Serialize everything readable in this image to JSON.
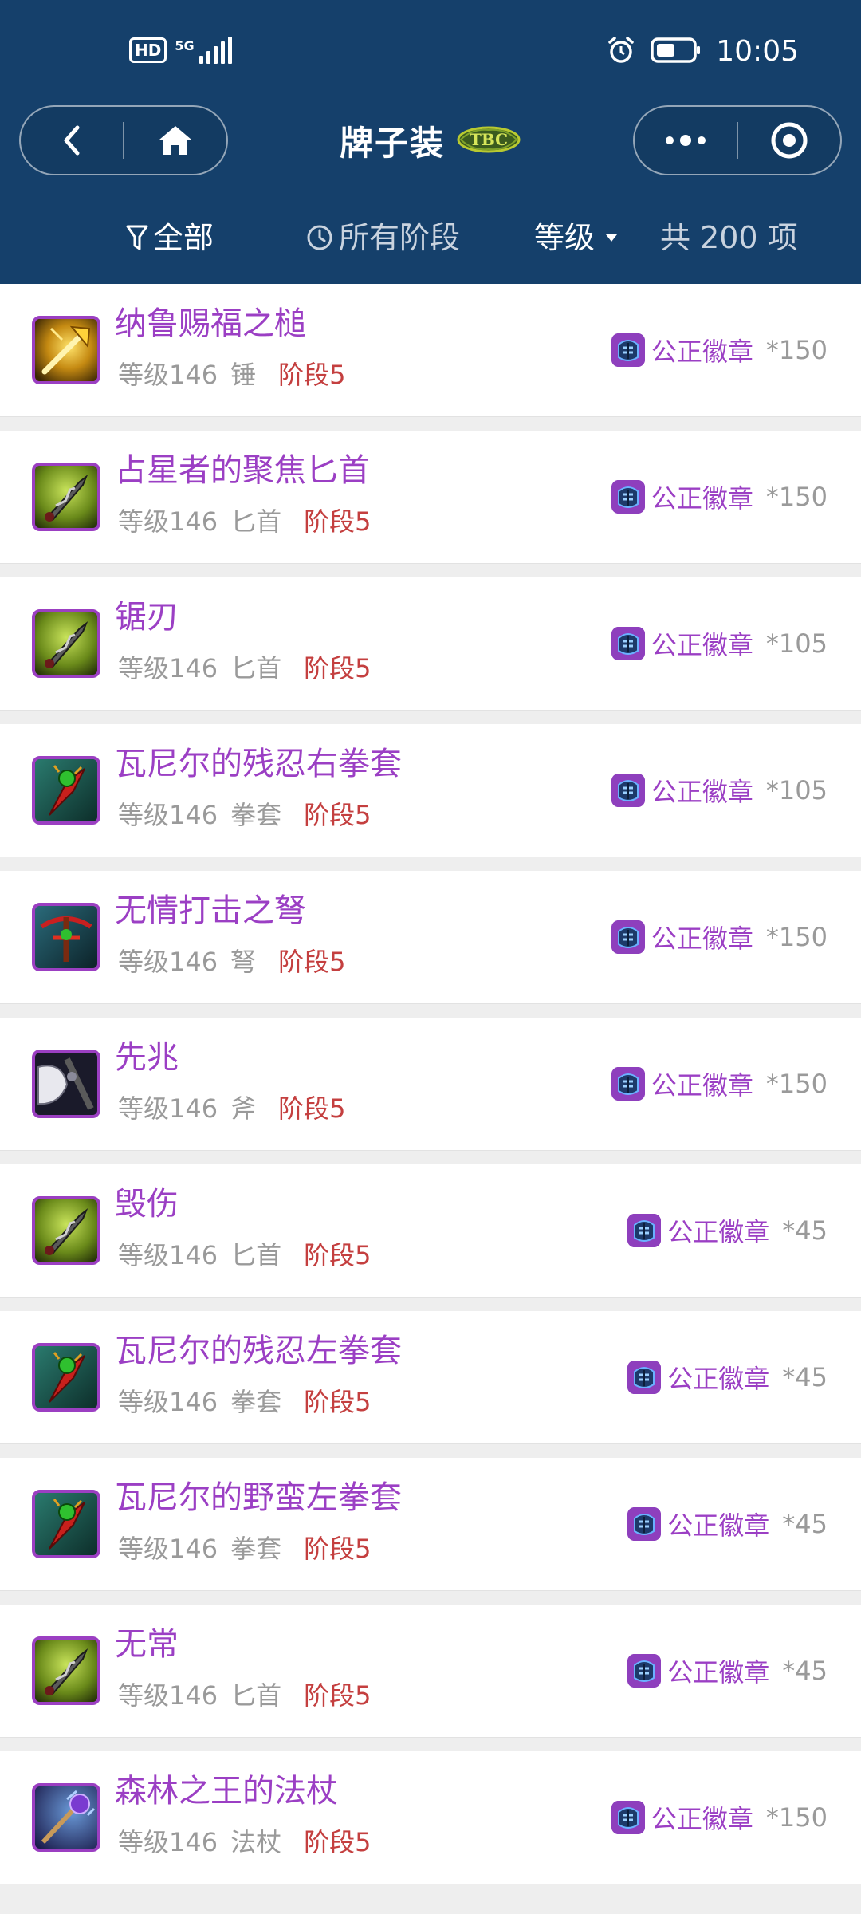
{
  "status_bar": {
    "hd": "HD",
    "network": "5G",
    "time": "10:05"
  },
  "header": {
    "title": "牌子装",
    "title_badge_text": "TBC"
  },
  "filters": {
    "all": "全部",
    "stage": "所有阶段",
    "level": "等级",
    "count": "共 200 项"
  },
  "items": [
    {
      "name": "纳鲁赐福之槌",
      "level": "等级146",
      "type": "锤",
      "stage": "阶段5",
      "currency": "公正徽章",
      "qty": "*150",
      "icon": "mace-icon"
    },
    {
      "name": "占星者的聚焦匕首",
      "level": "等级146",
      "type": "匕首",
      "stage": "阶段5",
      "currency": "公正徽章",
      "qty": "*150",
      "icon": "dagger-icon"
    },
    {
      "name": "锯刃",
      "level": "等级146",
      "type": "匕首",
      "stage": "阶段5",
      "currency": "公正徽章",
      "qty": "*105",
      "icon": "dagger-icon"
    },
    {
      "name": "瓦尼尔的残忍右拳套",
      "level": "等级146",
      "type": "拳套",
      "stage": "阶段5",
      "currency": "公正徽章",
      "qty": "*105",
      "icon": "fist-weapon-icon"
    },
    {
      "name": "无情打击之弩",
      "level": "等级146",
      "type": "弩",
      "stage": "阶段5",
      "currency": "公正徽章",
      "qty": "*150",
      "icon": "crossbow-icon"
    },
    {
      "name": "先兆",
      "level": "等级146",
      "type": "斧",
      "stage": "阶段5",
      "currency": "公正徽章",
      "qty": "*150",
      "icon": "axe-icon"
    },
    {
      "name": "毁伤",
      "level": "等级146",
      "type": "匕首",
      "stage": "阶段5",
      "currency": "公正徽章",
      "qty": "*45",
      "icon": "dagger-icon"
    },
    {
      "name": "瓦尼尔的残忍左拳套",
      "level": "等级146",
      "type": "拳套",
      "stage": "阶段5",
      "currency": "公正徽章",
      "qty": "*45",
      "icon": "fist-weapon-icon"
    },
    {
      "name": "瓦尼尔的野蛮左拳套",
      "level": "等级146",
      "type": "拳套",
      "stage": "阶段5",
      "currency": "公正徽章",
      "qty": "*45",
      "icon": "fist-weapon-icon"
    },
    {
      "name": "无常",
      "level": "等级146",
      "type": "匕首",
      "stage": "阶段5",
      "currency": "公正徽章",
      "qty": "*45",
      "icon": "dagger-icon"
    },
    {
      "name": "森林之王的法杖",
      "level": "等级146",
      "type": "法杖",
      "stage": "阶段5",
      "currency": "公正徽章",
      "qty": "*150",
      "icon": "staff-icon"
    }
  ],
  "colors": {
    "header_bg": "#15406b",
    "epic_purple": "#9b3fc4",
    "stage_red": "#c43f3f",
    "meta_gray": "#9a9a9a"
  }
}
